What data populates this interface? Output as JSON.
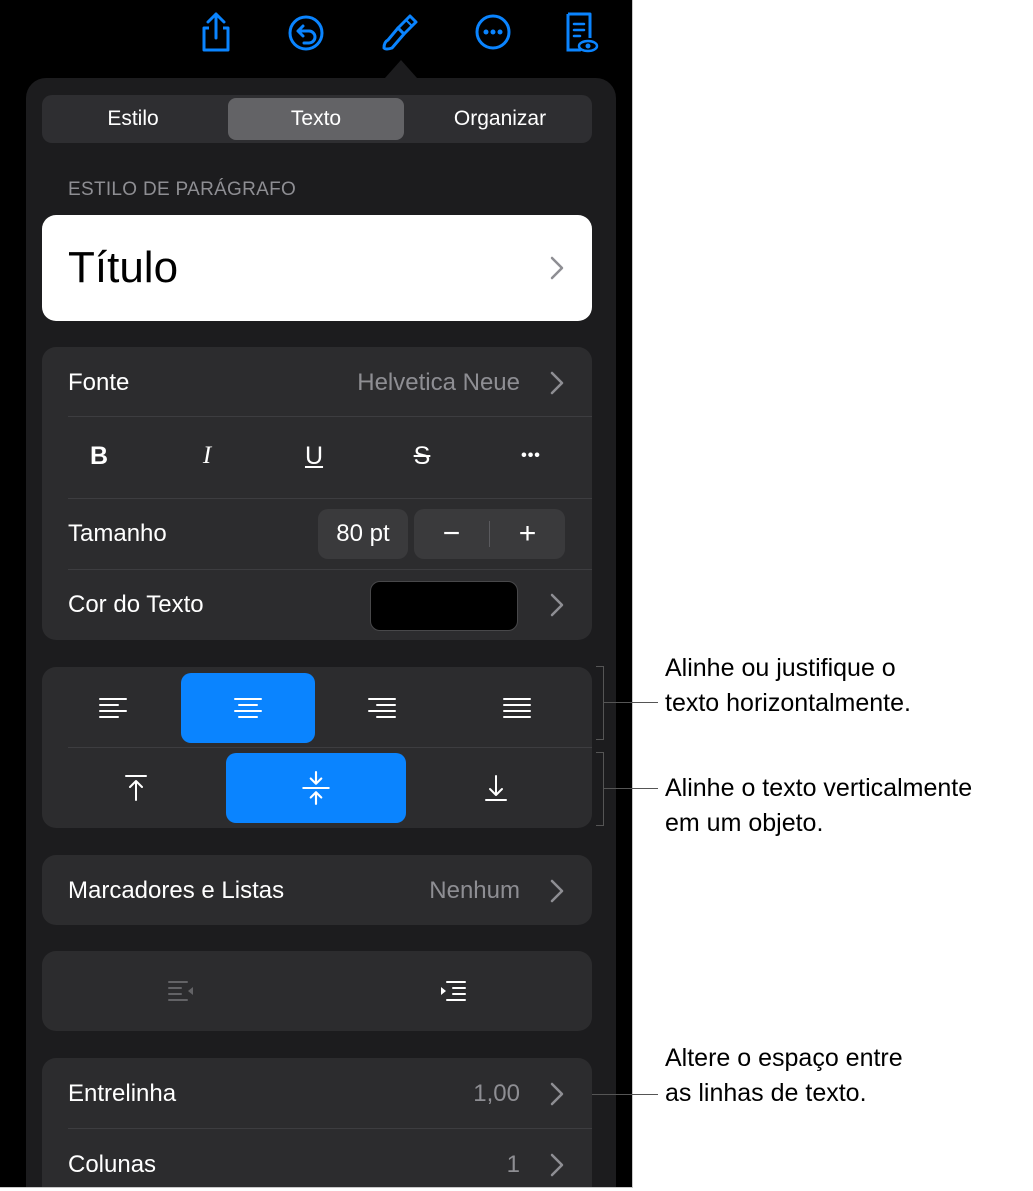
{
  "toolbar": {
    "icons": [
      "share-icon",
      "undo-icon",
      "paintbrush-icon",
      "more-icon",
      "document-view-icon"
    ],
    "accent": "#0a84ff"
  },
  "tabs": [
    {
      "label": "Estilo",
      "selected": false
    },
    {
      "label": "Texto",
      "selected": true
    },
    {
      "label": "Organizar",
      "selected": false
    }
  ],
  "paragraph_style": {
    "header": "ESTILO DE PARÁGRAFO",
    "value": "Título"
  },
  "font": {
    "label": "Fonte",
    "value": "Helvetica Neue",
    "format_buttons": [
      "B",
      "I",
      "U",
      "S",
      "•••"
    ],
    "size_label": "Tamanho",
    "size_value": "80 pt",
    "decrease": "−",
    "increase": "+",
    "color_label": "Cor do Texto",
    "color_value": "#000000"
  },
  "alignment": {
    "horizontal": [
      "align-left-icon",
      "align-center-icon",
      "align-right-icon",
      "justify-icon"
    ],
    "horizontal_selected": "align-center-icon",
    "vertical": [
      "align-top-icon",
      "align-middle-icon",
      "align-bottom-icon"
    ],
    "vertical_selected": "align-middle-icon"
  },
  "bullets": {
    "label": "Marcadores e Listas",
    "value": "Nenhum"
  },
  "indent": {
    "buttons": [
      "decrease-indent-icon",
      "increase-indent-icon"
    ]
  },
  "spacing": {
    "line_label": "Entrelinha",
    "line_value": "1,00",
    "columns_label": "Colunas",
    "columns_value": "1"
  },
  "annotations": {
    "horizontal": [
      "Alinhe ou justifique o",
      "texto horizontalmente."
    ],
    "vertical": [
      "Alinhe o texto verticalmente",
      "em um objeto."
    ],
    "spacing": [
      "Altere o espaço entre",
      "as linhas de texto."
    ]
  }
}
